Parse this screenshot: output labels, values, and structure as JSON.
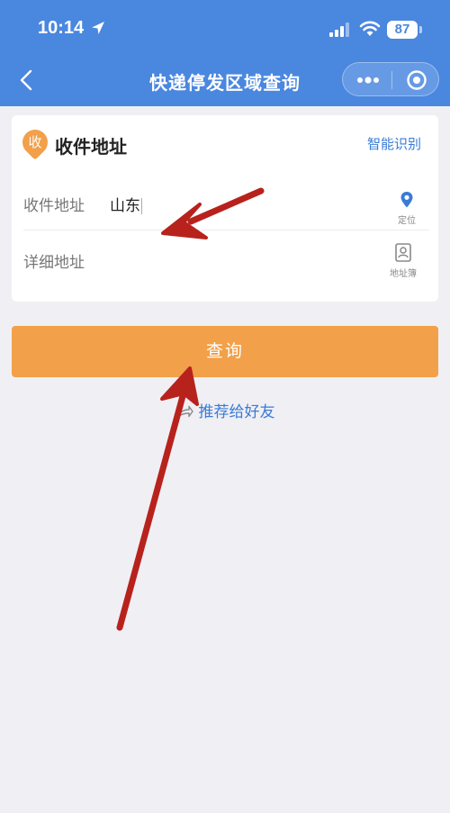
{
  "status_bar": {
    "time": "10:14",
    "battery": "87"
  },
  "nav": {
    "title": "快递停发区域查询"
  },
  "card": {
    "badge": "收",
    "title": "收件地址",
    "smart_recognize": "智能识别",
    "address_row": {
      "label": "收件地址",
      "value": "山东",
      "action": "定位"
    },
    "detail_row": {
      "label": "详细地址",
      "action": "地址簿"
    }
  },
  "query_button": "查询",
  "share_link": "推荐给好友",
  "annotation_color": "#b8221c"
}
